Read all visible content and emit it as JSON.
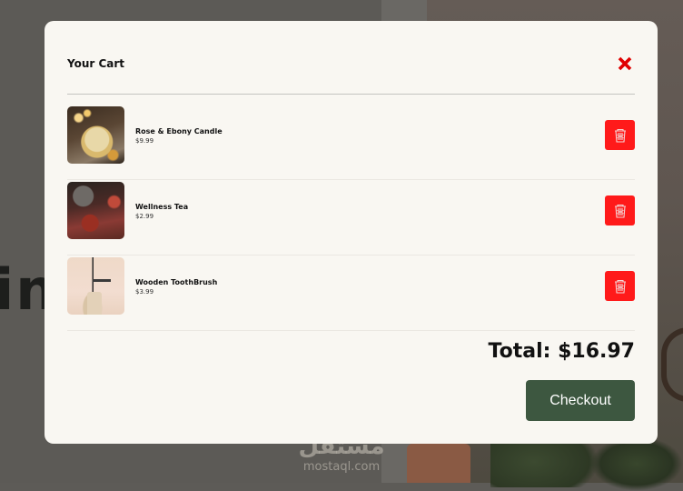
{
  "background": {
    "headline_fragment": "in",
    "watermark_arabic": "مستقل",
    "watermark_latin": "mostaql.com"
  },
  "cart": {
    "title": "Your Cart",
    "close_icon": "close-x-icon",
    "items": [
      {
        "name": "Rose & Ebony Candle",
        "price": "$9.99",
        "image": "candle-photo"
      },
      {
        "name": "Wellness Tea",
        "price": "$2.99",
        "image": "tea-photo"
      },
      {
        "name": "Wooden ToothBrush",
        "price": "$3.99",
        "image": "toothbrush-photo"
      }
    ],
    "delete_icon": "trash-icon",
    "total_label": "Total: $16.97",
    "checkout_label": "Checkout"
  },
  "colors": {
    "modal_bg": "#f9f7f2",
    "delete_red": "#ff1a1a",
    "close_red": "#e00000",
    "checkout_green": "#3d5740"
  }
}
